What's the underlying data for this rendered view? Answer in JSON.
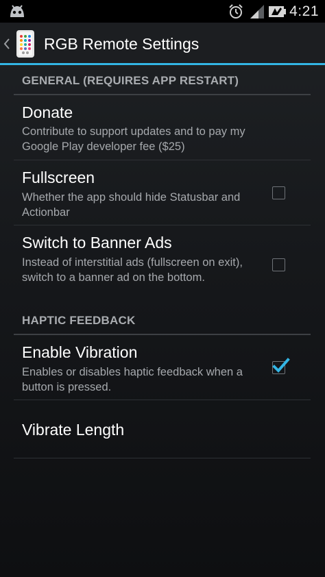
{
  "status_bar": {
    "time": "4:21",
    "icons": [
      "cyanogenmod-icon",
      "alarm-icon",
      "signal-icon",
      "battery-icon"
    ]
  },
  "action_bar": {
    "title": "RGB Remote Settings",
    "accent_color": "#33b5e5"
  },
  "categories": {
    "general": "GENERAL (REQUIRES APP RESTART)",
    "haptic": "HAPTIC FEEDBACK"
  },
  "preferences": {
    "donate": {
      "title": "Donate",
      "summary": "Contribute to support updates and to pay my Google Play developer fee ($25)"
    },
    "fullscreen": {
      "title": "Fullscreen",
      "summary": "Whether the app should hide Statusbar and Actionbar",
      "checked": false
    },
    "banner_ads": {
      "title": "Switch to Banner Ads",
      "summary": "Instead of interstitial ads (fullscreen on exit), switch to a banner ad on the bottom.",
      "checked": false
    },
    "vibration": {
      "title": "Enable Vibration",
      "summary": "Enables or disables haptic feedback when a button is pressed.",
      "checked": true
    },
    "vibrate_length": {
      "title": "Vibrate Length"
    }
  }
}
